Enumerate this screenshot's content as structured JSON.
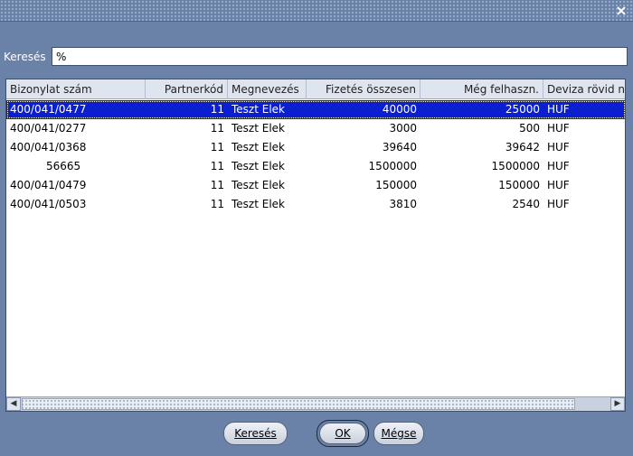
{
  "window": {
    "close_icon": "×"
  },
  "search": {
    "label": "Keresés",
    "value": "%"
  },
  "table": {
    "columns": [
      "Bizonylat szám",
      "Partnerkód",
      "Megnevezés",
      "Fizetés összesen",
      "Még felhaszn.",
      "Deviza rövid n"
    ],
    "rows": [
      [
        "400/041/0477",
        "11",
        "Teszt Elek",
        "40000",
        "25000",
        "HUF"
      ],
      [
        "400/041/0277",
        "11",
        "Teszt Elek",
        "3000",
        "500",
        "HUF"
      ],
      [
        "400/041/0368",
        "11",
        "Teszt Elek",
        "39640",
        "39642",
        "HUF"
      ],
      [
        "56665",
        "11",
        "Teszt Elek",
        "1500000",
        "1500000",
        "HUF"
      ],
      [
        "400/041/0479",
        "11",
        "Teszt Elek",
        "150000",
        "150000",
        "HUF"
      ],
      [
        "400/041/0503",
        "11",
        "Teszt Elek",
        "3810",
        "2540",
        "HUF"
      ]
    ],
    "selected_row": 0
  },
  "buttons": {
    "search_label": "Keresés",
    "ok_label": "OK",
    "cancel_label": "Mégse"
  }
}
